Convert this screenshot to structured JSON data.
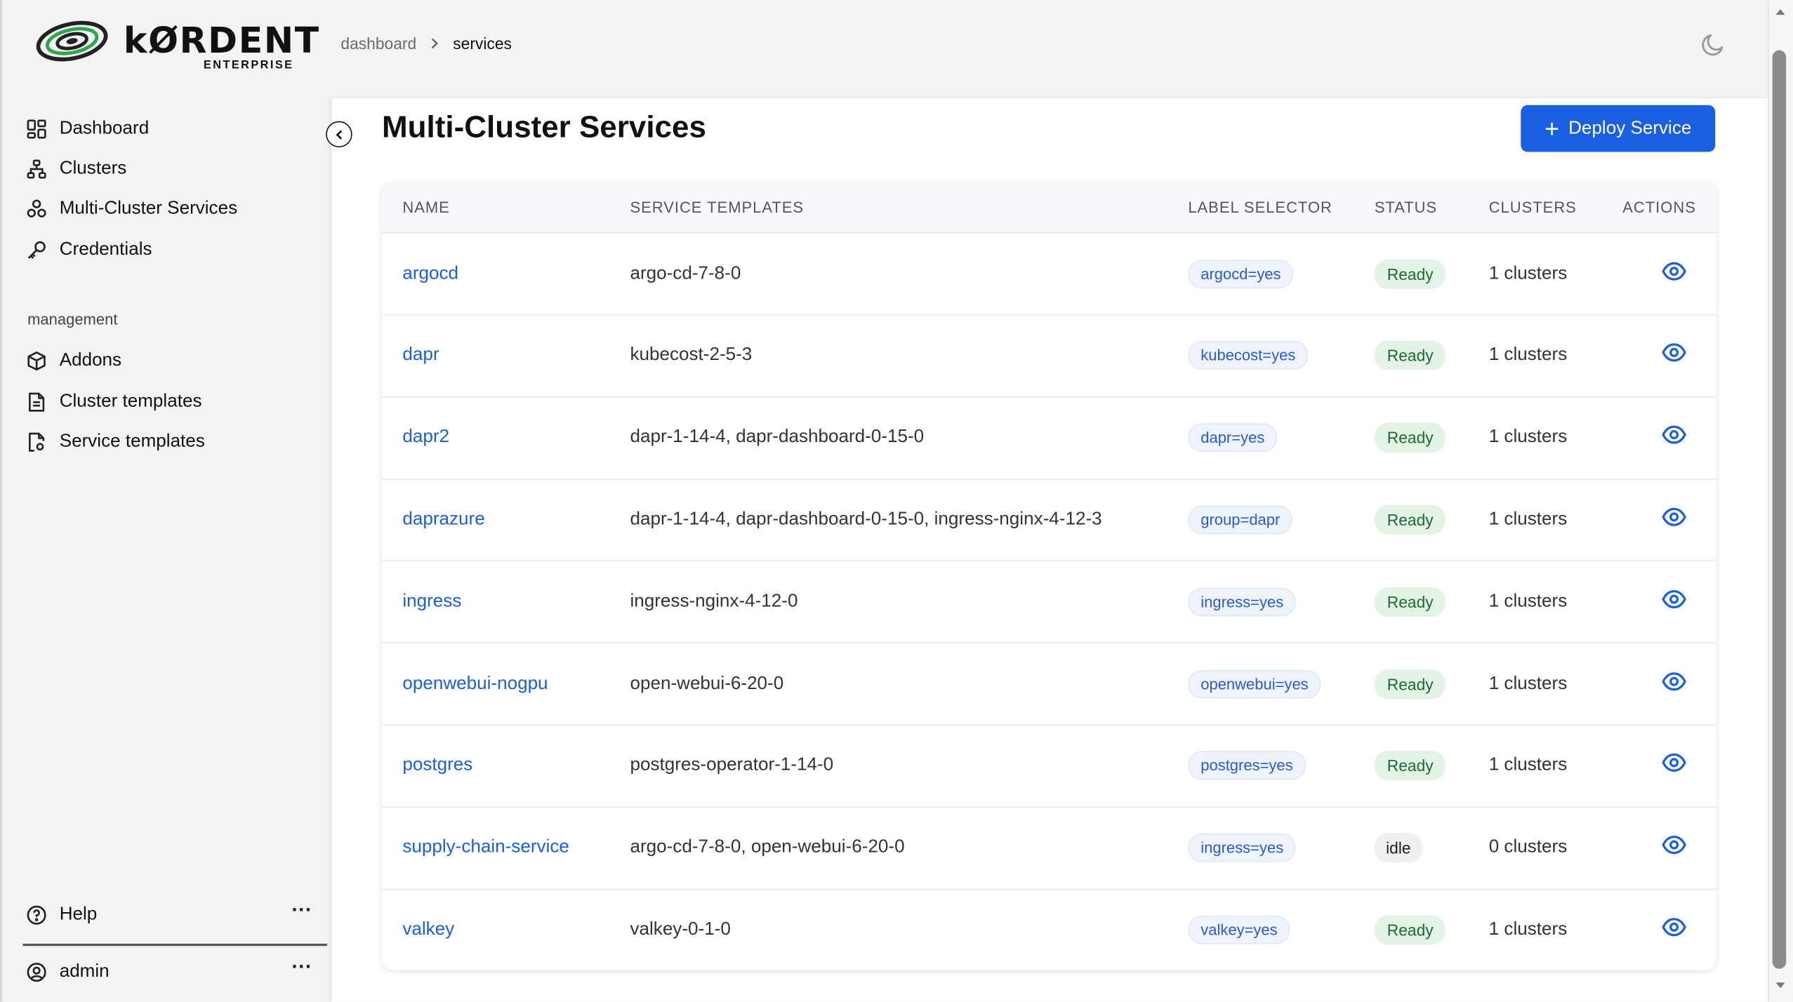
{
  "brand": {
    "name": "kØRDENT",
    "sub": "ENTERPRISE"
  },
  "breadcrumb": {
    "parent": "dashboard",
    "current": "services"
  },
  "sidebar": {
    "nav": [
      {
        "label": "Dashboard",
        "icon": "dashboard-grid-icon"
      },
      {
        "label": "Clusters",
        "icon": "cluster-network-icon"
      },
      {
        "label": "Multi-Cluster Services",
        "icon": "multi-cluster-icon"
      },
      {
        "label": "Credentials",
        "icon": "key-icon"
      }
    ],
    "management_label": "management",
    "management": [
      {
        "label": "Addons",
        "icon": "package-box-icon"
      },
      {
        "label": "Cluster templates",
        "icon": "document-icon"
      },
      {
        "label": "Service templates",
        "icon": "document-settings-icon"
      }
    ],
    "help": "Help",
    "user": "admin"
  },
  "page": {
    "title": "Multi-Cluster Services",
    "deploy_button": "Deploy Service"
  },
  "table": {
    "columns": [
      "NAME",
      "SERVICE TEMPLATES",
      "LABEL SELECTOR",
      "STATUS",
      "CLUSTERS",
      "ACTIONS"
    ],
    "rows": [
      {
        "name": "argocd",
        "templates": "argo-cd-7-8-0",
        "label": "argocd=yes",
        "status": "Ready",
        "clusters": "1 clusters"
      },
      {
        "name": "dapr",
        "templates": "kubecost-2-5-3",
        "label": "kubecost=yes",
        "status": "Ready",
        "clusters": "1 clusters"
      },
      {
        "name": "dapr2",
        "templates": "dapr-1-14-4, dapr-dashboard-0-15-0",
        "label": "dapr=yes",
        "status": "Ready",
        "clusters": "1 clusters"
      },
      {
        "name": "daprazure",
        "templates": "dapr-1-14-4, dapr-dashboard-0-15-0, ingress-nginx-4-12-3",
        "label": "group=dapr",
        "status": "Ready",
        "clusters": "1 clusters"
      },
      {
        "name": "ingress",
        "templates": "ingress-nginx-4-12-0",
        "label": "ingress=yes",
        "status": "Ready",
        "clusters": "1 clusters"
      },
      {
        "name": "openwebui-nogpu",
        "templates": "open-webui-6-20-0",
        "label": "openwebui=yes",
        "status": "Ready",
        "clusters": "1 clusters"
      },
      {
        "name": "postgres",
        "templates": "postgres-operator-1-14-0",
        "label": "postgres=yes",
        "status": "Ready",
        "clusters": "1 clusters"
      },
      {
        "name": "supply-chain-service",
        "templates": "argo-cd-7-8-0, open-webui-6-20-0",
        "label": "ingress=yes",
        "status": "idle",
        "clusters": "0 clusters"
      },
      {
        "name": "valkey",
        "templates": "valkey-0-1-0",
        "label": "valkey=yes",
        "status": "Ready",
        "clusters": "1 clusters"
      }
    ]
  },
  "colors": {
    "accent": "#1a5fe0",
    "ready_bg": "#e3f4e7",
    "ready_text": "#1c6b32",
    "idle_bg": "#f0f0f0",
    "chip_bg": "#eef3fc",
    "chip_text": "#2a5bd7"
  }
}
